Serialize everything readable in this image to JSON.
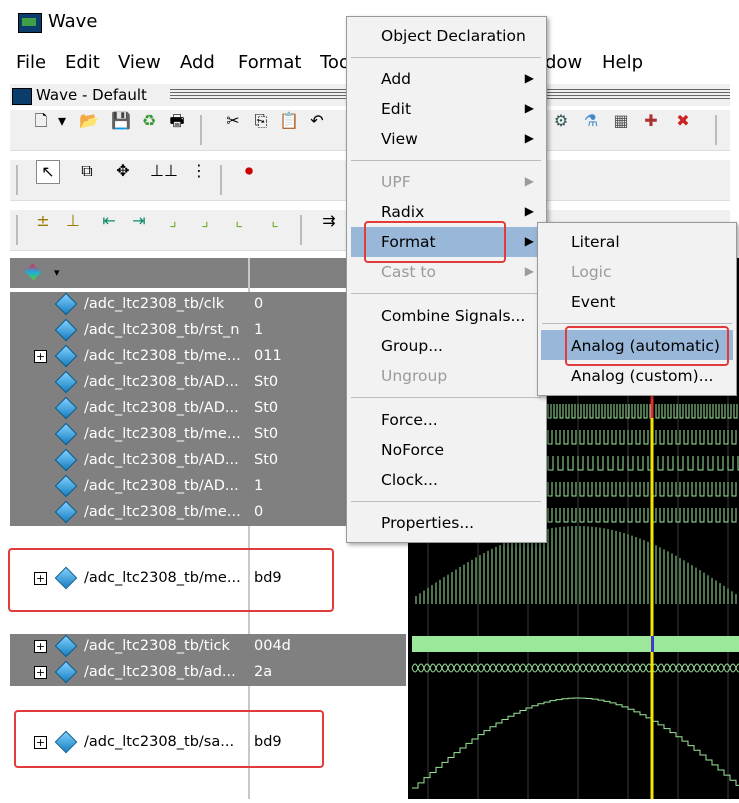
{
  "window": {
    "title": "Wave"
  },
  "menubar": [
    "File",
    "Edit",
    "View",
    "Add",
    "Format",
    "Too",
    "dow",
    "Help"
  ],
  "subwindow": {
    "title": "Wave - Default"
  },
  "signals": [
    {
      "name": "/adc_ltc2308_tb/clk",
      "value": "0",
      "expand": false
    },
    {
      "name": "/adc_ltc2308_tb/rst_n",
      "value": "1",
      "expand": false
    },
    {
      "name": "/adc_ltc2308_tb/me...",
      "value": "011",
      "expand": true
    },
    {
      "name": "/adc_ltc2308_tb/AD...",
      "value": "St0",
      "expand": false
    },
    {
      "name": "/adc_ltc2308_tb/AD...",
      "value": "St0",
      "expand": false
    },
    {
      "name": "/adc_ltc2308_tb/me...",
      "value": "St0",
      "expand": false
    },
    {
      "name": "/adc_ltc2308_tb/AD...",
      "value": "St0",
      "expand": false
    },
    {
      "name": "/adc_ltc2308_tb/AD...",
      "value": "1",
      "expand": false
    },
    {
      "name": "/adc_ltc2308_tb/me...",
      "value": "0",
      "expand": false
    }
  ],
  "analog_signal_1": {
    "name": "/adc_ltc2308_tb/me...",
    "value": "bd9"
  },
  "signals_lower": [
    {
      "name": "/adc_ltc2308_tb/tick",
      "value": "004d"
    },
    {
      "name": "/adc_ltc2308_tb/ad...",
      "value": "2a"
    }
  ],
  "analog_signal_2": {
    "name": "/adc_ltc2308_tb/sa...",
    "value": "bd9"
  },
  "context_menu": {
    "items": [
      {
        "label": "Object Declaration"
      },
      {
        "label": "Add"
      },
      {
        "label": "Edit"
      },
      {
        "label": "View"
      },
      {
        "label": "UPF"
      },
      {
        "label": "Radix"
      },
      {
        "label": "Format"
      },
      {
        "label": "Cast to"
      },
      {
        "label": "Combine Signals..."
      },
      {
        "label": "Group..."
      },
      {
        "label": "Ungroup"
      },
      {
        "label": "Force..."
      },
      {
        "label": "NoForce"
      },
      {
        "label": "Clock..."
      },
      {
        "label": "Properties..."
      }
    ]
  },
  "format_submenu": {
    "items": [
      "Literal",
      "Logic",
      "Event",
      "Analog (automatic)",
      "Analog (custom)..."
    ]
  },
  "colors": {
    "highlight": "#99b7d8",
    "annotation": "#e23b3b",
    "wave_green": "#9be89b",
    "cursor": "#f2e600"
  }
}
